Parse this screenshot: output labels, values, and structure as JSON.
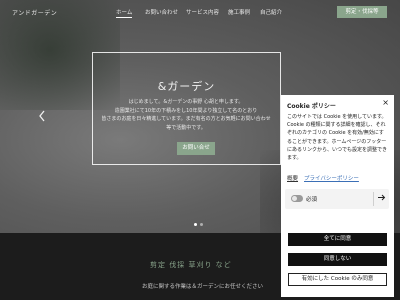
{
  "header": {
    "brand": "アンドガーデン",
    "nav": [
      {
        "label": "ホーム",
        "active": true
      },
      {
        "label": "お問い合わせ",
        "active": false
      },
      {
        "label": "サービス内容",
        "active": false
      },
      {
        "label": "施工事例",
        "active": false
      },
      {
        "label": "自己紹介",
        "active": false
      }
    ],
    "cta_label": "剪定・伐採等"
  },
  "hero": {
    "title": "&ガーデン",
    "text_lines": [
      "はじめまして。&ガーデンの事野 心胡と申します。",
      "造園業社にて10年の下積みをし10年間より独立して名のとおり",
      "皆さまのお庭を日々精進しています。まだ有名の方とお気軽にお問い合わせ",
      "等で活動中です。"
    ],
    "button_label": "お問い合せ",
    "slide_count": 2,
    "active_slide": 0
  },
  "services": {
    "title": "剪定 伐採 草刈り など",
    "subtitle": "お庭に関する作業は＆ガーデンにお任せください"
  },
  "cookie_modal": {
    "title": "Cookie ポリシー",
    "close": "×",
    "description_lines": [
      "このサイトでは Cookie を使用しています。",
      "Cookie の種類に関する詳細を確認し、それ",
      "ぞれのカテゴリの Cookie を有効/無効にす",
      "ることができます。ホームページのフッター",
      "にあるリンクから、いつでも設定を調整でき",
      "ます。"
    ],
    "links": {
      "overview": "概要",
      "privacy": "プライバシーポリシー"
    },
    "required_toggle": {
      "label": "必須",
      "state": "on"
    },
    "buttons": {
      "accept_all": "全てに同意",
      "decline": "同意しない",
      "accept_selected": "有効にした Cookie のみ同意"
    }
  }
}
